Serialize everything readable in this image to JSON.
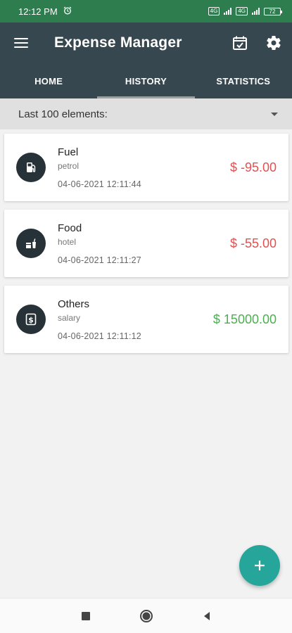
{
  "status_bar": {
    "time": "12:12 PM",
    "battery": "72",
    "sim1": "4G",
    "sim2": "4G"
  },
  "app_bar": {
    "title": "Expense Manager",
    "icons": [
      "menu-icon",
      "calendar-check-icon",
      "settings-icon"
    ]
  },
  "tabs": [
    {
      "label": "HOME",
      "active": false
    },
    {
      "label": "HISTORY",
      "active": true
    },
    {
      "label": "STATISTICS",
      "active": false
    }
  ],
  "filter": {
    "label": "Last 100 elements:"
  },
  "transactions": [
    {
      "category": "Fuel",
      "note": "petrol",
      "datetime": "04-06-2021 12:11:44",
      "amount": "$ -95.00",
      "type": "expense",
      "icon": "fuel-icon"
    },
    {
      "category": "Food",
      "note": "hotel",
      "datetime": "04-06-2021 12:11:27",
      "amount": "$ -55.00",
      "type": "expense",
      "icon": "food-icon"
    },
    {
      "category": "Others",
      "note": "salary",
      "datetime": "04-06-2021 12:11:12",
      "amount": "$ 15000.00",
      "type": "income",
      "icon": "dollar-icon"
    }
  ],
  "colors": {
    "status_bar": "#2e7d4f",
    "app_bar": "#37474f",
    "expense": "#e05252",
    "income": "#4caf50",
    "fab": "#26a69a"
  }
}
